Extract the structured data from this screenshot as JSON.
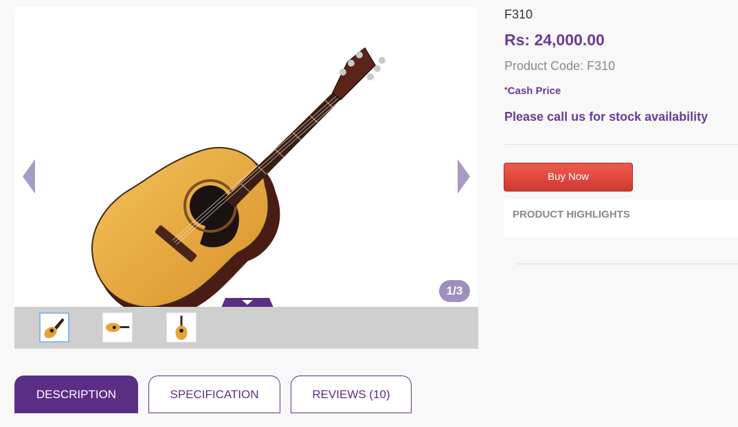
{
  "product": {
    "model": "F310",
    "price": "Rs: 24,000.00",
    "code": "Product Code: F310",
    "cash_star": "*",
    "cash_label": "Cash Price",
    "stock_note": "Please call us for stock availability",
    "buy_label": "Buy Now",
    "highlights_label": "PRODUCT HIGHLIGHTS"
  },
  "gallery": {
    "counter": "1/3",
    "current": 1,
    "total": 3,
    "thumbnails": [
      "guitar-angled",
      "guitar-horizontal",
      "guitar-front"
    ]
  },
  "tabs": [
    {
      "label": "DESCRIPTION",
      "active": true
    },
    {
      "label": "SPECIFICATION",
      "active": false
    },
    {
      "label": "REVIEWS (10)",
      "active": false
    }
  ],
  "colors": {
    "brand_purple": "#5b2e86",
    "price_purple": "#6a3b97",
    "buy_red": "#d9443a"
  }
}
